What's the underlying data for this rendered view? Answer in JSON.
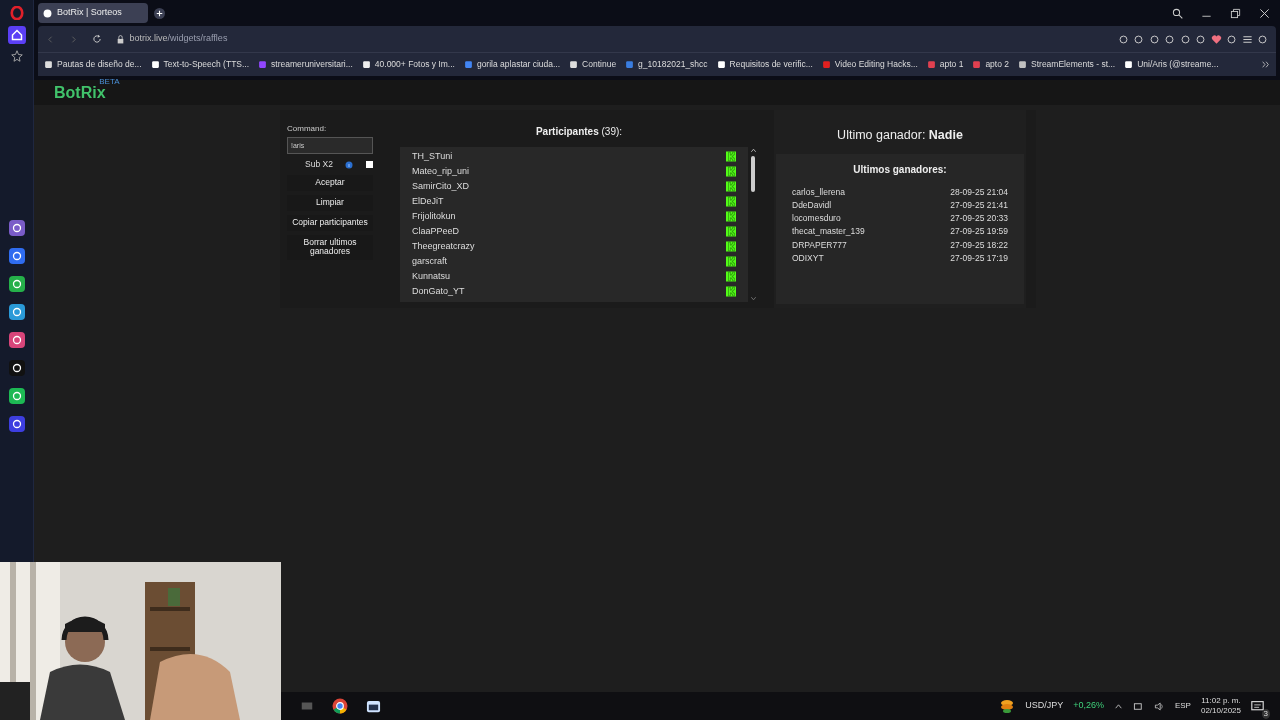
{
  "browser": {
    "tab_title": "BotRix | Sorteos",
    "url_host": "botrix.live",
    "url_path": "/widgets/raffles",
    "bookmarks": [
      "Pautas de diseño de...",
      "Text-to-Speech (TTS...",
      "streameruniversitari...",
      "40.000+ Fotos y Im...",
      "gorila aplastar ciuda...",
      "Continue",
      "g_10182021_shcc",
      "Requisitos de verific...",
      "Video Editing Hacks...",
      "apto 1",
      "apto 2",
      "StreamElements - st...",
      "Uni/Aris (@streame..."
    ]
  },
  "app": {
    "logo": "BotRix",
    "logo_badge": "BETA"
  },
  "raffle": {
    "command_label": "Command:",
    "command_value": "!aris",
    "sub_x2": {
      "label": "Sub X2",
      "checked": false
    },
    "buttons": [
      "Aceptar",
      "Limpiar",
      "Copiar participantes",
      "Borrar ultimos ganadores"
    ],
    "participants_title": "**Participantes** (39):",
    "participants": [
      "TH_STuni",
      "Mateo_rip_uni",
      "SamirCito_XD",
      "ElDeJiT",
      "Frijolitokun",
      "ClaaPPeeD",
      "Theegreatcrazy",
      "garscraft",
      "Kunnatsu",
      "DonGato_YT"
    ],
    "last_winner": "Ultimo ganador: **Nadie**",
    "winners_title": "Ultimos ganadores:",
    "winners": [
      {
        "name": "carlos_llerena",
        "date": "28-09-25 21:04"
      },
      {
        "name": "DdeDavidl",
        "date": "27-09-25 21:41"
      },
      {
        "name": "locomesduro",
        "date": "27-09-25 20:33"
      },
      {
        "name": "thecat_master_139",
        "date": "27-09-25 19:59"
      },
      {
        "name": "DRPAPER777",
        "date": "27-09-25 18:22"
      },
      {
        "name": "ODIXYT",
        "date": "27-09-25 17:19"
      }
    ]
  },
  "taskbar": {
    "ticker": "USD/JPY",
    "change": "+0,26%",
    "language": "ESP",
    "time": "11:02 p. m.",
    "date": "02/10/2025",
    "notifications": "3"
  }
}
